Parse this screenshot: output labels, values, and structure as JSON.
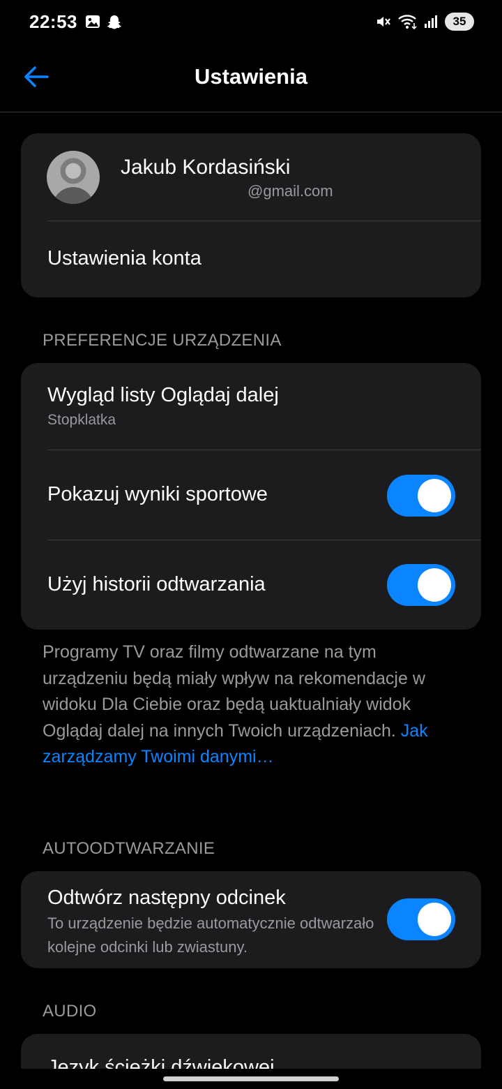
{
  "status_bar": {
    "time": "22:53",
    "battery": "35",
    "icons": [
      "image-icon",
      "snapchat-icon",
      "mute-icon",
      "wifi-icon",
      "signal-icon",
      "battery-icon"
    ]
  },
  "header": {
    "title": "Ustawienia",
    "back_icon": "arrow-left-icon",
    "accent": "#0a84ff"
  },
  "account": {
    "name": "Jakub Kordasiński",
    "email_visible": "@gmail.com",
    "settings_label": "Ustawienia konta"
  },
  "device_preferences": {
    "heading": "PREFERENCJE URZĄDZENIA",
    "watch_next": {
      "label": "Wygląd listy Oglądaj dalej",
      "value": "Stopklatka"
    },
    "sports_scores": {
      "label": "Pokazuj wyniki sportowe",
      "enabled": true
    },
    "playback_history": {
      "label": "Użyj historii odtwarzania",
      "enabled": true
    },
    "info_text": "Programy TV oraz filmy odtwarzane na tym urządzeniu będą miały wpływ na rekomendacje w widoku Dla Ciebie oraz będą uaktualniały widok Oglądaj dalej na innych Twoich urządzeniach. ",
    "info_link": "Jak zarządzamy Twoimi danymi…"
  },
  "autoplay": {
    "heading": "AUTOODTWARZANIE",
    "next_episode": {
      "label": "Odtwórz następny odcinek",
      "description": "To urządzenie będzie automatycznie odtwarzało kolejne odcinki lub zwiastuny.",
      "enabled": true
    }
  },
  "audio": {
    "heading": "AUDIO",
    "track_language_label": "Język ścieżki dźwiękowej"
  }
}
